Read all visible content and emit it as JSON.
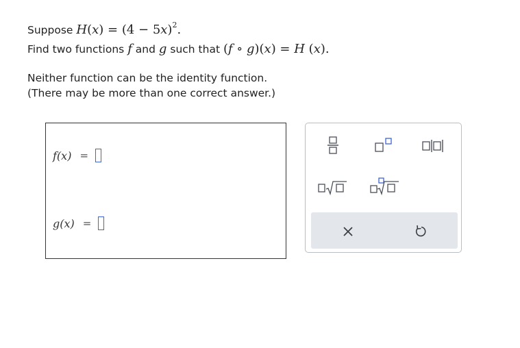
{
  "question": {
    "suppose_word": "Suppose",
    "find_prefix": "Find two functions",
    "and_word": "and",
    "such_that": "such that",
    "note_line1": "Neither function can be the identity function.",
    "note_line2": "(There may be more than one correct answer.)"
  },
  "answers": {
    "f_label": "f(x)",
    "g_label": "g(x)",
    "equals": "=",
    "f_value": "",
    "g_value": ""
  },
  "palette": {
    "tools": [
      "fraction-icon",
      "exponent-icon",
      "absolute-value-icon",
      "square-root-icon",
      "nth-root-icon"
    ],
    "actions": [
      "clear-icon",
      "undo-icon"
    ],
    "icon_color": "#4a4f57",
    "action_bg": "#e3e7ec"
  },
  "colors": {
    "input_border": "#3f63d9"
  }
}
